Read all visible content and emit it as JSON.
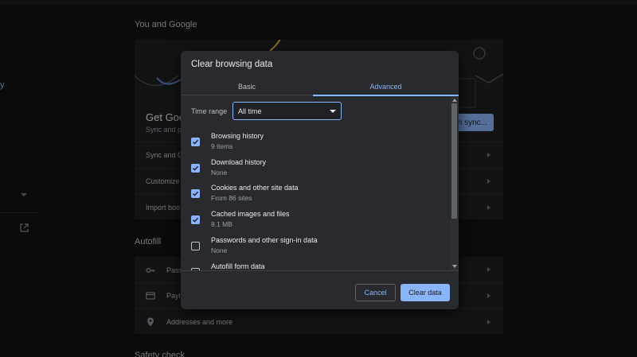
{
  "background": {
    "left_nav": {
      "fragment_text": "y"
    },
    "you_and_google": {
      "heading": "You and Google",
      "card_title": "Get Goo",
      "card_subtitle": "Sync and p",
      "sync_button": "n sync...",
      "rows": [
        {
          "label": "Sync and G"
        },
        {
          "label": "Customize"
        },
        {
          "label": "Import boo"
        }
      ]
    },
    "autofill": {
      "heading": "Autofill",
      "rows": [
        {
          "label": "Pass",
          "icon": "key-icon"
        },
        {
          "label": "Paym",
          "icon": "credit-card-icon"
        },
        {
          "label": "Addresses and more",
          "icon": "location-pin-icon"
        }
      ]
    },
    "safety_check": {
      "heading": "Safety check"
    }
  },
  "dialog": {
    "title": "Clear browsing data",
    "tabs": [
      {
        "label": "Basic",
        "selected": false
      },
      {
        "label": "Advanced",
        "selected": true
      }
    ],
    "time_range": {
      "label": "Time range",
      "value": "All time"
    },
    "items": [
      {
        "title": "Browsing history",
        "subtitle": "9 items",
        "checked": true
      },
      {
        "title": "Download history",
        "subtitle": "None",
        "checked": true
      },
      {
        "title": "Cookies and other site data",
        "subtitle": "From 86 sites",
        "checked": true
      },
      {
        "title": "Cached images and files",
        "subtitle": "8.1 MB",
        "checked": true
      },
      {
        "title": "Passwords and other sign-in data",
        "subtitle": "None",
        "checked": false
      },
      {
        "title": "Autofill form data",
        "subtitle": "",
        "checked": false
      }
    ],
    "buttons": {
      "cancel": "Cancel",
      "clear": "Clear data"
    }
  },
  "colors": {
    "accent": "#8ab4f8",
    "dialog_bg": "#292a2d",
    "page_bg": "#121212"
  }
}
